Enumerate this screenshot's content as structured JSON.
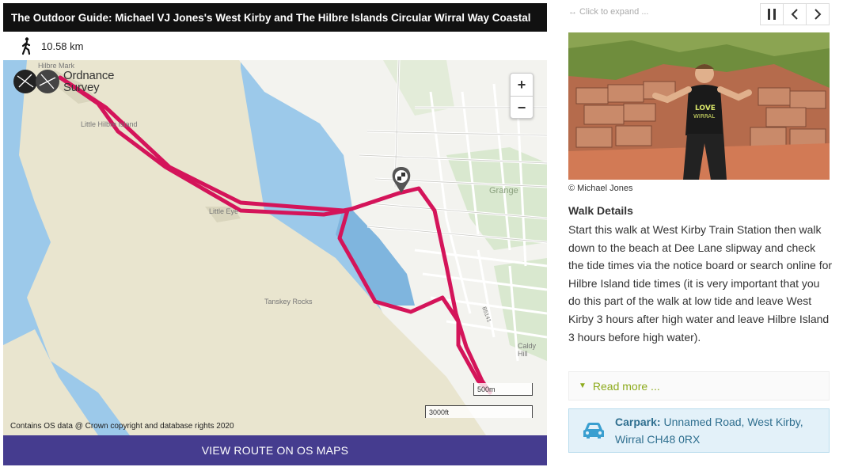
{
  "page": {
    "title": "The Outdoor Guide: Michael VJ Jones's West Kirby and The Hilbre Islands Circular Wirral Way Coastal",
    "distance": "10.58 km",
    "distance_icon": "walking-person-icon"
  },
  "map": {
    "logo_text_line1": "Ordnance",
    "logo_text_line2": "Survey",
    "zoom_in": "+",
    "zoom_out": "−",
    "labels": {
      "hilbre_mark": "Hilbre Mark",
      "little_hilbre": "Little Hilbre Island",
      "grange": "Grange",
      "tanskey": "Tanskey Rocks",
      "caldy": "Caldy Hill",
      "road": "B5141",
      "little_eye": "Little Eye"
    },
    "scale_metric": "500m",
    "scale_imperial": "3000ft",
    "copyright": "Contains OS data @ Crown copyright and database rights 2020",
    "route_color": "#d4145a",
    "water_color": "#9cc9ea",
    "sand_color": "#e9e5cf"
  },
  "cta": {
    "label": "View route on OS Maps"
  },
  "gallery": {
    "expand_hint": "↔ Click to expand ...",
    "pause_icon": "pause-icon",
    "prev_icon": "chevron-left-icon",
    "next_icon": "chevron-right-icon",
    "photo_credit": "© Michael Jones"
  },
  "details": {
    "heading": "Walk Details",
    "text": "Start this walk at West Kirby Train Station then walk down to the beach at Dee Lane slipway and check the tide times via the notice board or search online for Hilbre Island tide times (it is very important that you do this part of the walk at low tide and leave West Kirby 3 hours after high water and leave Hilbre Island 3 hours before high water).",
    "read_more": "Read more ...",
    "accent": "#8dab1d"
  },
  "carpark": {
    "label": "Carpark:",
    "address": "Unnamed Road, West Kirby, Wirral CH48 0RX",
    "icon": "car-icon"
  }
}
